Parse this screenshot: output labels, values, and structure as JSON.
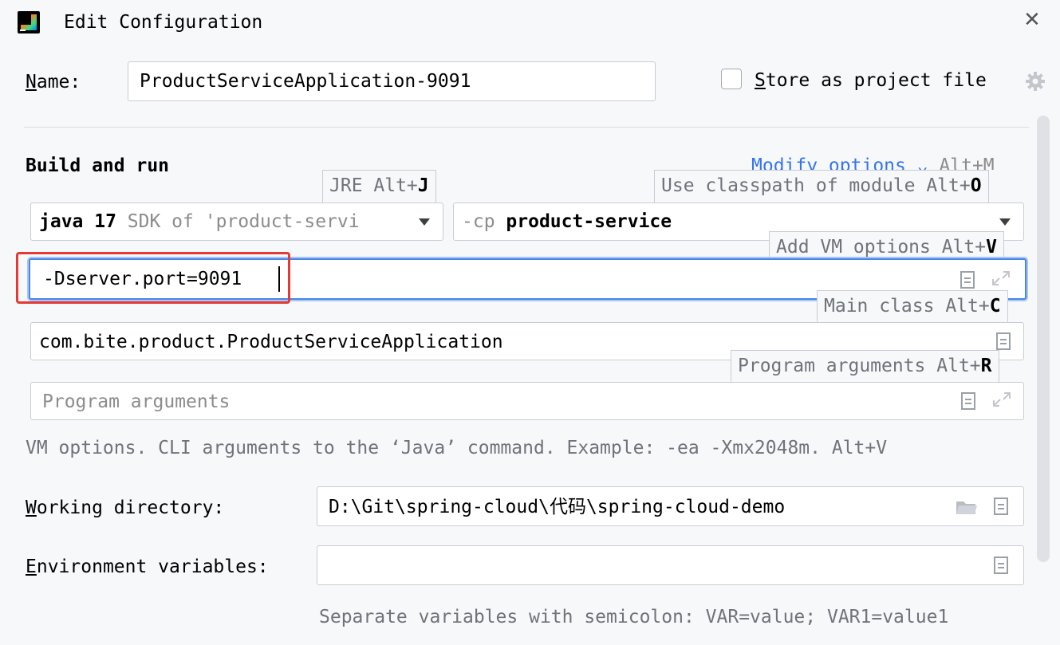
{
  "window": {
    "title": "Edit Configuration"
  },
  "name_field": {
    "label_prefix": "N",
    "label_rest": "ame:",
    "value": "ProductServiceApplication-9091"
  },
  "store": {
    "label_prefix": "S",
    "label_rest": "tore as project file",
    "checked": false
  },
  "section": {
    "title": "Build and run",
    "modify_link": "Modify options",
    "modify_shortcut": "Alt+M"
  },
  "tooltips": {
    "jre": {
      "text": "JRE Alt+",
      "key": "J"
    },
    "classpath": {
      "text": "Use classpath of module Alt+",
      "key": "O"
    },
    "vm": {
      "text": "Add VM options Alt+",
      "key": "V"
    },
    "main": {
      "text": "Main class Alt+",
      "key": "C"
    },
    "args": {
      "text": "Program arguments Alt+",
      "key": "R"
    }
  },
  "jre_select": {
    "value_bold": "java 17",
    "value_muted": "SDK of 'product-servi"
  },
  "cp_select": {
    "prefix": "-cp",
    "value": "product-service"
  },
  "vm_options": {
    "value": "-Dserver.port=9091"
  },
  "main_class": {
    "value": "com.bite.product.ProductServiceApplication"
  },
  "program_args": {
    "placeholder": "Program arguments"
  },
  "hint": "VM options. CLI arguments to the ‘Java’ command. Example: -ea -Xmx2048m. Alt+V",
  "working_dir": {
    "label_prefix": "W",
    "label_rest": "orking directory:",
    "value": "D:\\Git\\spring-cloud\\代码\\spring-cloud-demo"
  },
  "env_vars": {
    "label_prefix": "E",
    "label_rest": "nvironment variables:",
    "value": "",
    "hint": "Separate variables with semicolon: VAR=value; VAR1=value1"
  },
  "colors": {
    "accent": "#4a86e8",
    "link": "#3574f0",
    "highlight": "#e53935",
    "background": "#f7f8fa"
  }
}
